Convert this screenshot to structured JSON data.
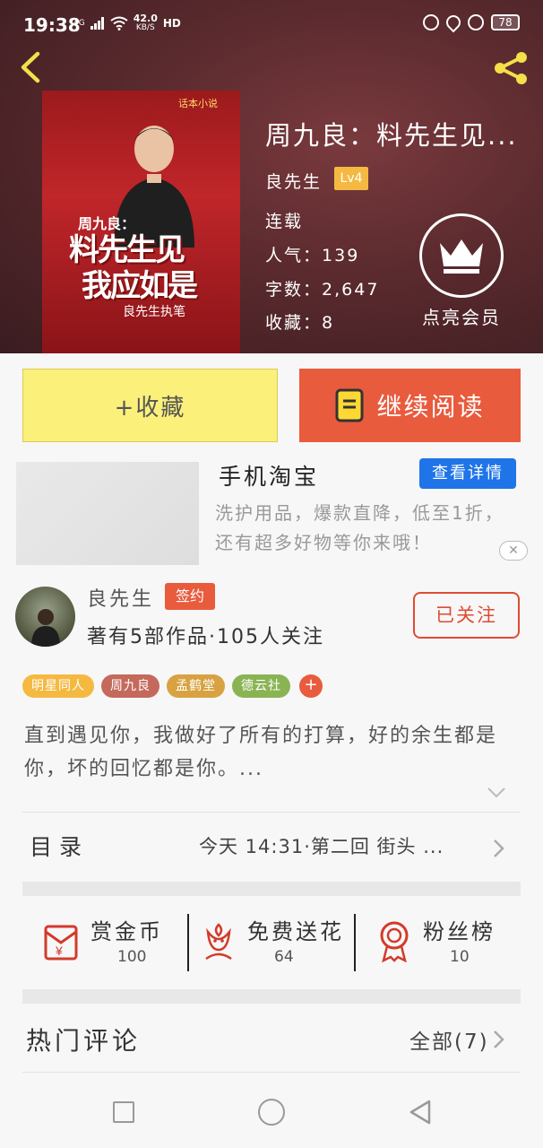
{
  "status_bar": {
    "time": "19:38",
    "network_type": "4G",
    "speed_value": "42.0",
    "speed_unit": "KB/S",
    "hd": "HD",
    "battery": "78"
  },
  "book": {
    "title": "周九良：料先生见...",
    "author": "良先生",
    "author_level": "Lv4",
    "status": "连载",
    "popularity_label": "人气：",
    "popularity": "139",
    "word_count_label": "字数：",
    "word_count": "2,647",
    "favorites_label": "收藏：",
    "favorites": "8",
    "vip_label": "点亮会员",
    "cover": {
      "logo_text": "话本小说",
      "line1": "周九良：",
      "line2": "料先生见",
      "line3": "我应如是",
      "line4": "良先生执笔"
    }
  },
  "actions": {
    "collect_label": "+收藏",
    "read_label": "继续阅读"
  },
  "ad": {
    "title": "手机淘宝",
    "button_label": "查看详情",
    "description": "洗护用品，爆款直降，低至1折，还有超多好物等你来哦！",
    "close_symbol": "✕"
  },
  "author": {
    "name": "良先生",
    "signed_label": "签约",
    "stats": "著有5部作品·105人关注",
    "follow_label": "已关注"
  },
  "tags": [
    {
      "label": "明星同人",
      "color": "#f5b942"
    },
    {
      "label": "周九良",
      "color": "#c46a5c"
    },
    {
      "label": "孟鹤堂",
      "color": "#d8a242"
    },
    {
      "label": "德云社",
      "color": "#8ab454"
    }
  ],
  "tag_add_symbol": "+",
  "synopsis": "直到遇见你，我做好了所有的打算，好的余生都是你，坏的回忆都是你。...",
  "catalog": {
    "label": "目录",
    "latest": "今天 14:31·第二回 街头 ..."
  },
  "rewards": [
    {
      "label": "赏金币",
      "count": "100",
      "icon": "red-envelope-icon"
    },
    {
      "label": "免费送花",
      "count": "64",
      "icon": "flower-icon"
    },
    {
      "label": "粉丝榜",
      "count": "10",
      "icon": "medal-icon"
    }
  ],
  "comments": {
    "title": "热门评论",
    "all_label": "全部(7)"
  },
  "colors": {
    "accent": "#e95b3d",
    "collect_bg": "#fbf07a",
    "ad_button": "#1f74e8"
  }
}
